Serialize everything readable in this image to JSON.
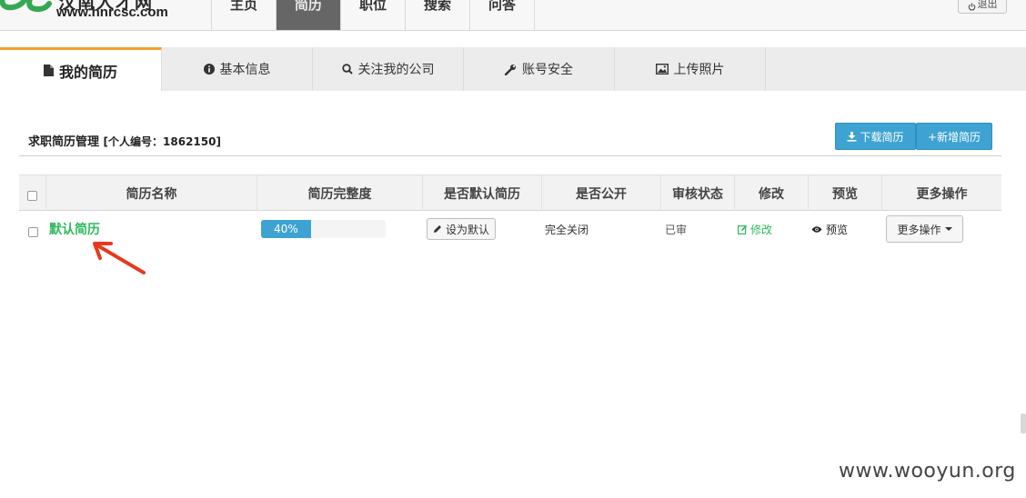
{
  "header": {
    "logo_cn": "汉南人才网",
    "logo_url": "www.hnrcsc.com",
    "nav": [
      "主页",
      "简历",
      "职位",
      "搜索",
      "问答"
    ],
    "active_nav_index": 1,
    "logout_label": "退出"
  },
  "tabs": [
    {
      "label": "我的简历",
      "icon": "file-icon"
    },
    {
      "label": "基本信息",
      "icon": "info-icon"
    },
    {
      "label": "关注我的公司",
      "icon": "search-icon"
    },
    {
      "label": "账号安全",
      "icon": "wrench-icon"
    },
    {
      "label": "上传照片",
      "icon": "picture-icon"
    }
  ],
  "active_tab_index": 0,
  "section": {
    "title": "求职简历管理",
    "id_text": "[个人编号：1862150]",
    "download_label": "下载简历",
    "add_label": "+新增简历"
  },
  "table": {
    "headers": [
      "简历名称",
      "简历完整度",
      "是否默认简历",
      "是否公开",
      "审核状态",
      "修改",
      "预览",
      "更多操作"
    ],
    "rows": [
      {
        "name": "默认简历",
        "completeness": 0.4,
        "completeness_label": "40%",
        "set_default_label": "设为默认",
        "visibility": "完全关闭",
        "status": "已审",
        "edit_label": "修改",
        "preview_label": "预览",
        "more_label": "更多操作"
      }
    ]
  },
  "colors": {
    "accent_blue": "#3ea3d2",
    "link_green": "#2dbb5c",
    "tab_active_border": "#f0a030",
    "annotation_red": "#e8391d"
  },
  "watermark": "www.wooyun.org"
}
